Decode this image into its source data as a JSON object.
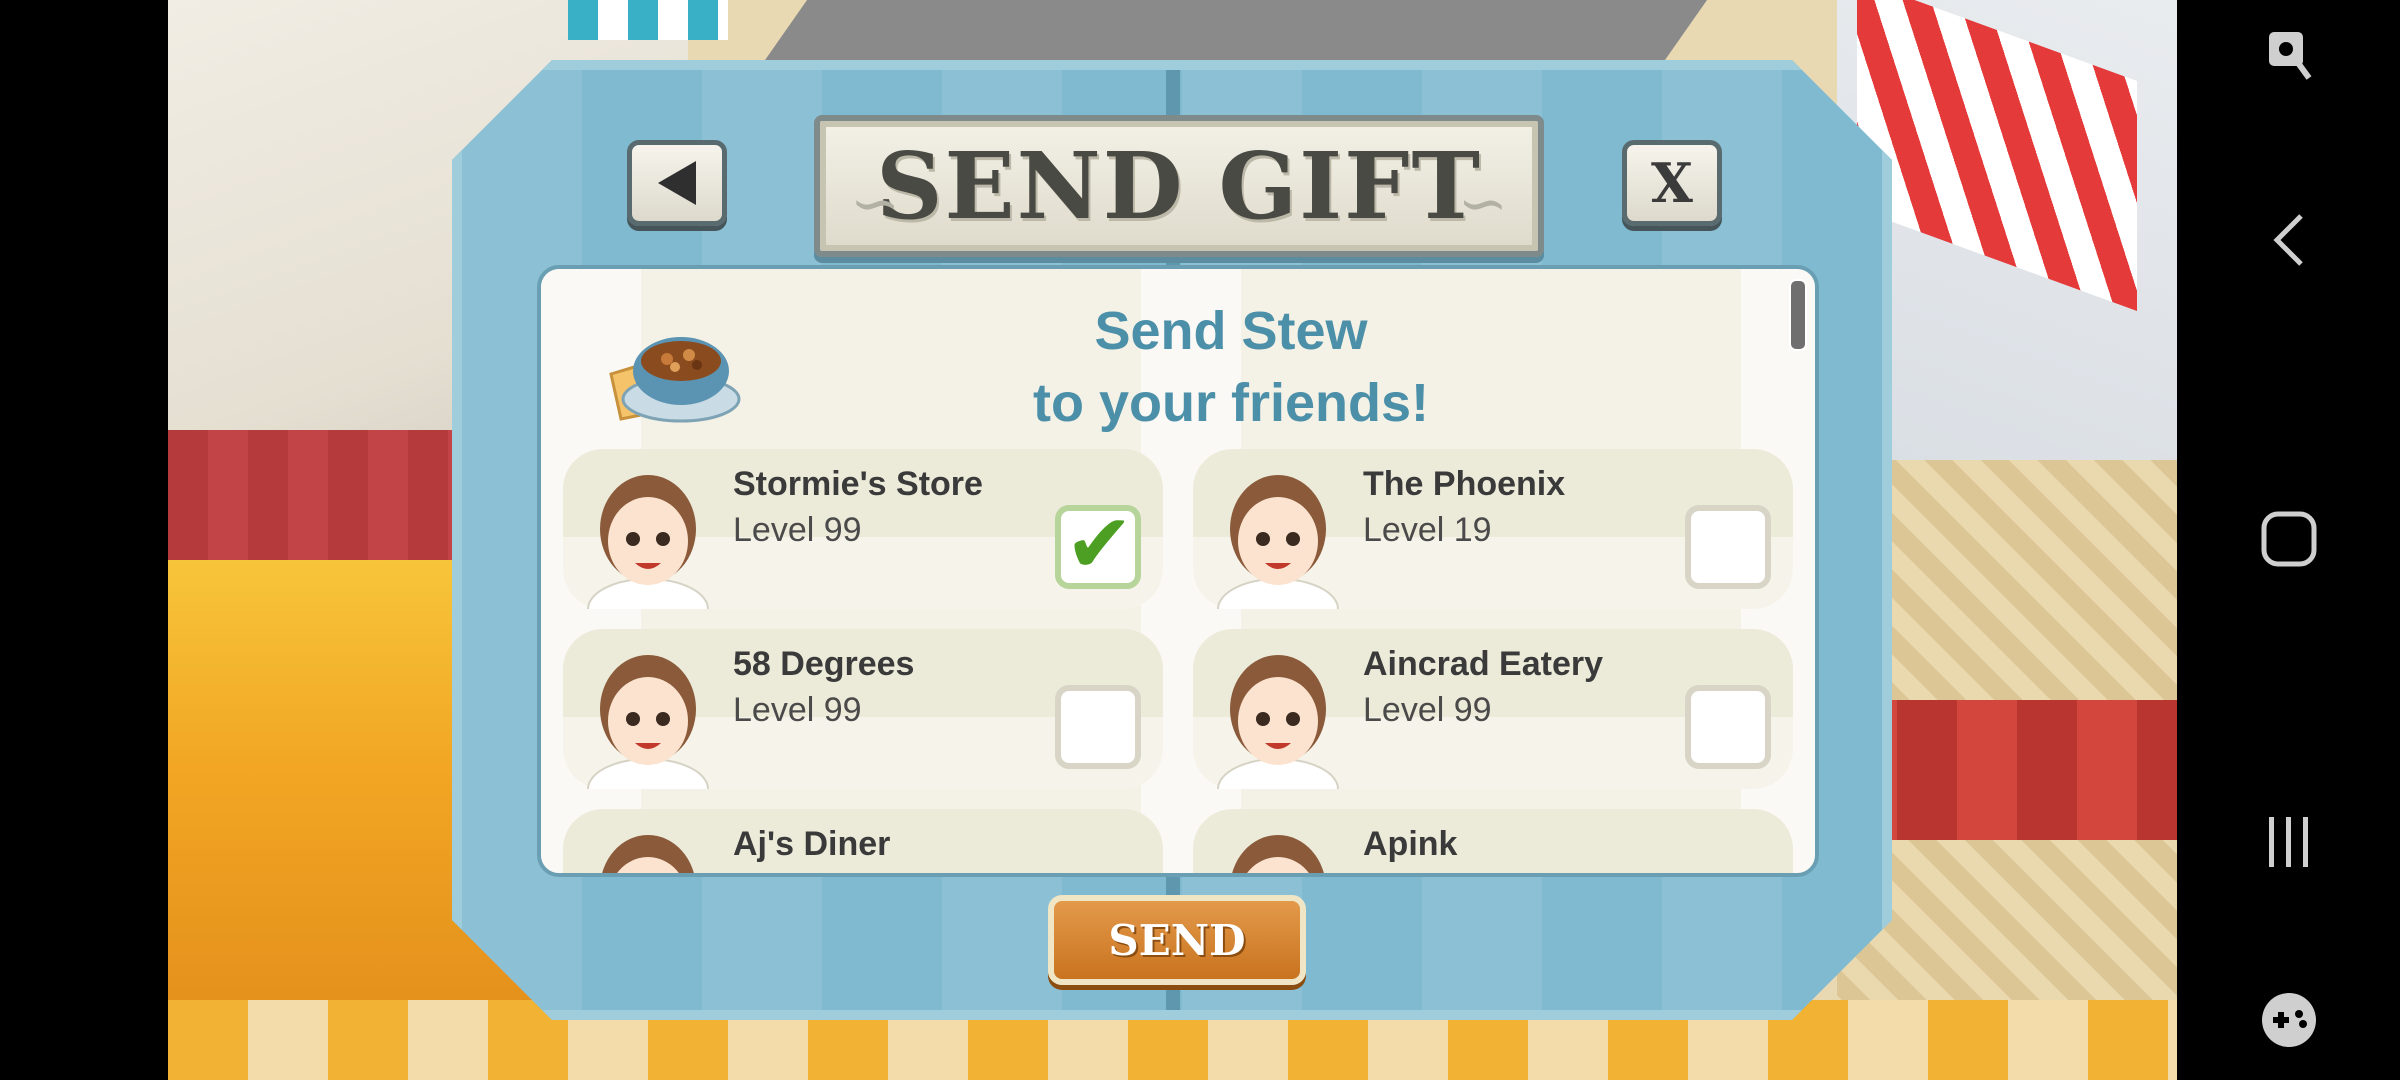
{
  "dialog": {
    "title": "SEND GIFT",
    "back_icon": "triangle-left-icon",
    "close_label": "X",
    "message_line1": "Send Stew",
    "message_line2": "to your friends!",
    "gift_item_icon": "stew-bowl-icon",
    "send_label": "SEND"
  },
  "friends": [
    {
      "name": "Stormie's Store",
      "level": "Level 99",
      "checked": true
    },
    {
      "name": "The Phoenix",
      "level": "Level 19",
      "checked": false
    },
    {
      "name": "58 Degrees",
      "level": "Level 99",
      "checked": false
    },
    {
      "name": "Aincrad Eatery",
      "level": "Level 99",
      "checked": false
    },
    {
      "name": "Aj's Diner",
      "level": "",
      "checked": false
    },
    {
      "name": "Apink",
      "level": "",
      "checked": false
    }
  ],
  "system_nav": {
    "icons": [
      "accessibility-icon",
      "back-icon",
      "home-icon",
      "recents-icon",
      "game-tools-icon"
    ]
  },
  "colors": {
    "dialog_blue": "#7fbad0",
    "title_text": "#4a4a44",
    "message_text": "#4b8fa8",
    "send_button": "#c9731f",
    "check_green": "#4d9f23"
  }
}
